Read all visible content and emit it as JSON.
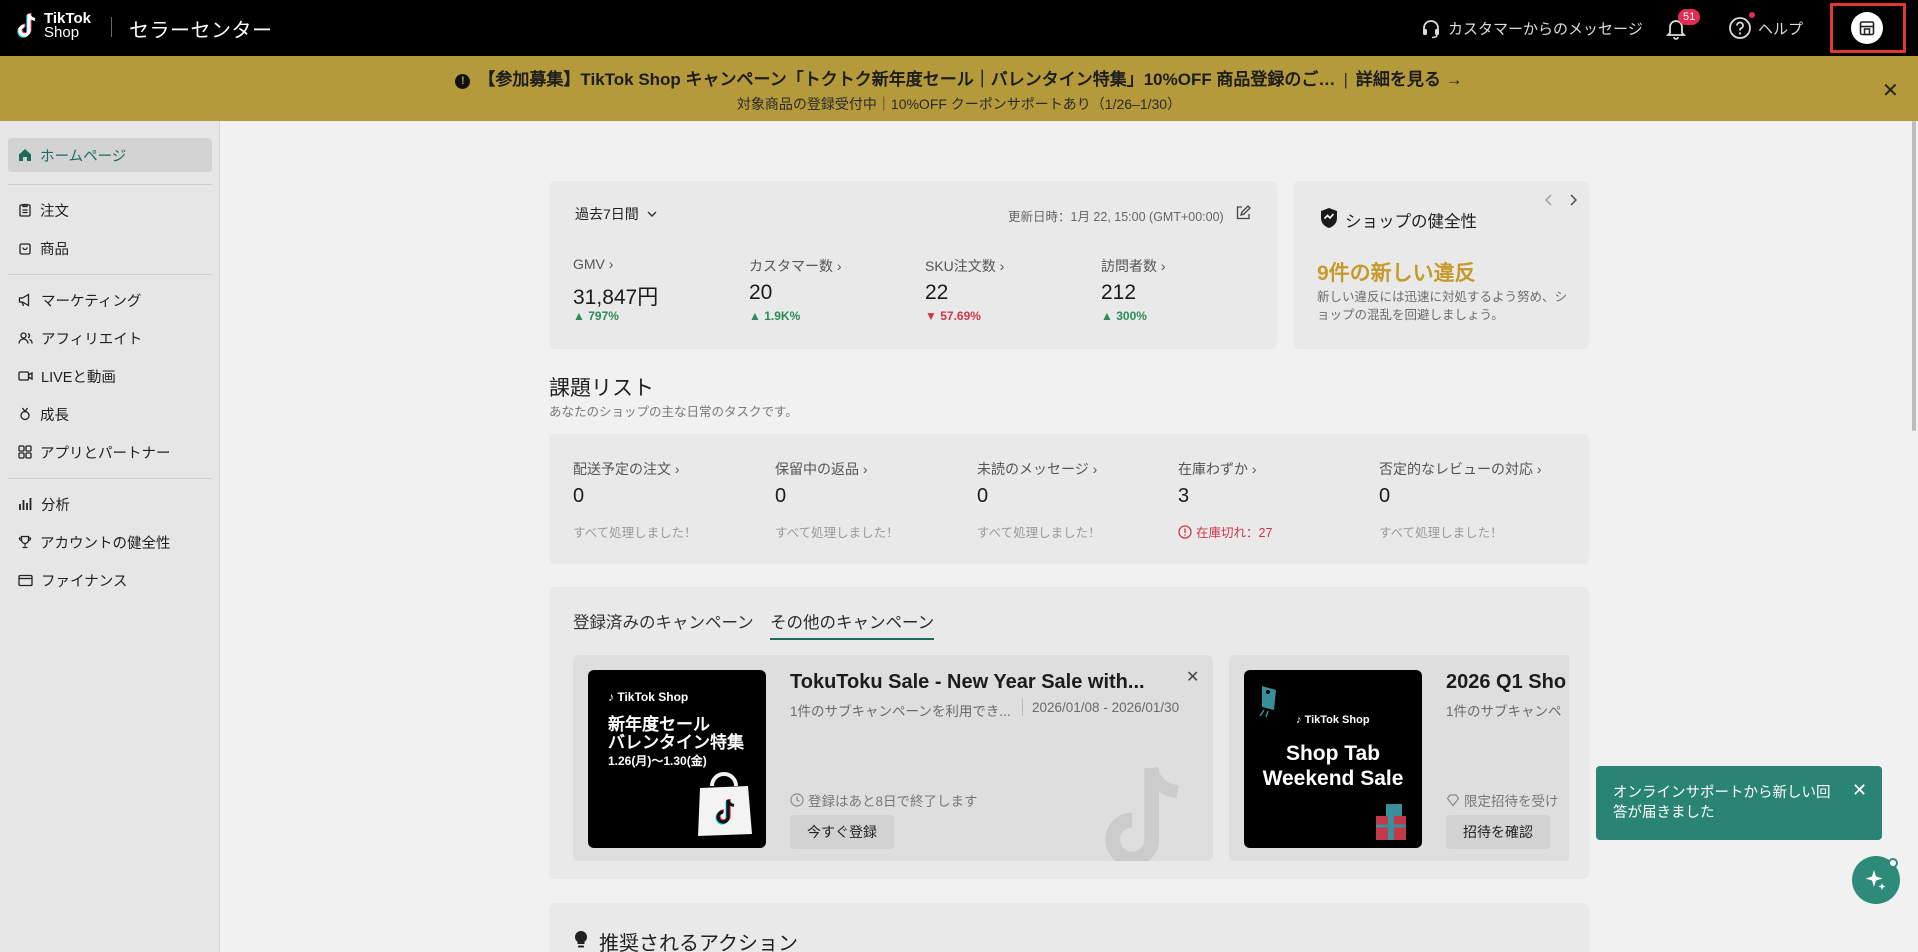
{
  "header": {
    "logo_line1": "TikTok",
    "logo_line2": "Shop",
    "app_title": "セラーセンター",
    "customer_messages": "カスタマーからのメッセージ",
    "notification_count": "51",
    "help": "ヘルプ"
  },
  "banner": {
    "warn_glyph": "!",
    "title": "【参加募集】TikTok Shop キャンペーン「トクトク新年度セール｜バレンタイン特集」10%OFF 商品登録のご…",
    "separator": "|",
    "link": "詳細を見る →",
    "subtitle": "対象商品の登録受付中｜10%OFF クーポンサポートあり（1/26–1/30）",
    "close": "✕"
  },
  "sidebar": {
    "items": [
      {
        "label": "ホームページ"
      },
      {
        "label": "注文"
      },
      {
        "label": "商品"
      },
      {
        "label": "マーケティング"
      },
      {
        "label": "アフィリエイト"
      },
      {
        "label": "LIVEと動画"
      },
      {
        "label": "成長"
      },
      {
        "label": "アプリとパートナー"
      },
      {
        "label": "分析"
      },
      {
        "label": "アカウントの健全性"
      },
      {
        "label": "ファイナンス"
      }
    ]
  },
  "stats": {
    "period": "過去7日間",
    "updated": "更新日時：1月 22, 15:00 (GMT+00:00)",
    "metrics": [
      {
        "label": "GMV",
        "value": "31,847円",
        "change": "797%",
        "direction": "up"
      },
      {
        "label": "カスタマー数",
        "value": "20",
        "change": "1.9K%",
        "direction": "up"
      },
      {
        "label": "SKU注文数",
        "value": "22",
        "change": "57.69%",
        "direction": "down"
      },
      {
        "label": "訪問者数",
        "value": "212",
        "change": "300%",
        "direction": "up"
      }
    ]
  },
  "health": {
    "title": "ショップの健全性",
    "violations": "9件の新しい違反",
    "description": "新しい違反には迅速に対処するよう努め、ショップの混乱を回避しましょう。",
    "accent": "#c49a2a"
  },
  "tasks": {
    "title": "課題リスト",
    "subtitle": "あなたのショップの主な日常のタスクです。",
    "items": [
      {
        "label": "配送予定の注文",
        "value": "0",
        "note": "すべて処理しました！"
      },
      {
        "label": "保留中の返品",
        "value": "0",
        "note": "すべて処理しました！"
      },
      {
        "label": "未読のメッセージ",
        "value": "0",
        "note": "すべて処理しました！"
      },
      {
        "label": "在庫わずか",
        "value": "3",
        "note": "在庫切れ：27"
      },
      {
        "label": "否定的なレビューの対応",
        "value": "0",
        "note": "すべて処理しました！"
      }
    ]
  },
  "campaigns": {
    "tabs": [
      "登録済みのキャンペーン",
      "その他のキャンペーン"
    ],
    "cards": [
      {
        "brand": "TikTok Shop",
        "img_line1": "新年度セール",
        "img_line2": "バレンタイン特集",
        "img_line3": "1.26(月)〜1.30(金)",
        "title": "TokuToku Sale - New Year Sale with...",
        "sub": "1件のサブキャンペーンを利用でき...",
        "dates": "2026/01/08 - 2026/01/30",
        "status": "登録はあと8日で終了します",
        "button": "今すぐ登録",
        "close": "✕"
      },
      {
        "brand": "TikTok Shop",
        "img_line1": "Shop Tab",
        "img_line2": "Weekend Sale",
        "title": "2026 Q1 Sho",
        "sub": "1件のサブキャンペ",
        "status": "限定招待を受け",
        "button": "招待を確認"
      }
    ]
  },
  "recommended": {
    "title": "推奨されるアクション"
  },
  "toast": {
    "message": "オンラインサポートから新しい回答が届きました",
    "close": "✕"
  },
  "colors": {
    "accent_green": "#1f6b5b",
    "banner": "#b59a3c",
    "up": "#2e8b57",
    "down": "#d0364a"
  }
}
